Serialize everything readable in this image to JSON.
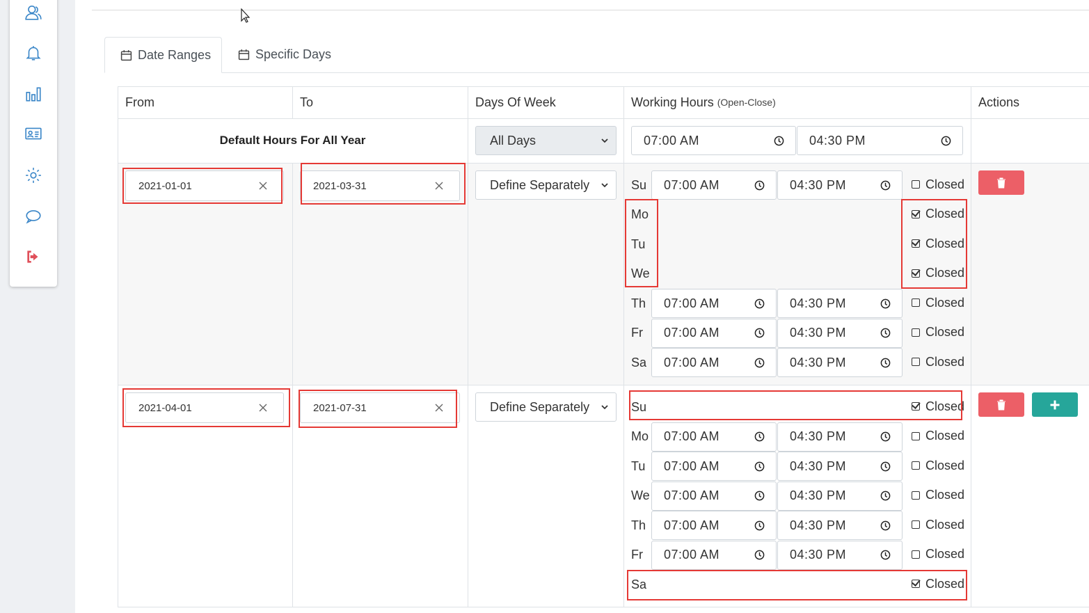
{
  "sidebar": {
    "icons": [
      "users-icon",
      "bell-icon",
      "bar-chart-icon",
      "id-card-icon",
      "gear-icon",
      "chat-icon",
      "sign-out-icon"
    ]
  },
  "tabs": [
    {
      "label": "Date Ranges",
      "icon": "calendar-icon",
      "active": true
    },
    {
      "label": "Specific Days",
      "icon": "calendar-icon",
      "active": false
    }
  ],
  "table": {
    "headers": {
      "from": "From",
      "to": "To",
      "days_of_week": "Days Of Week",
      "working_hours": "Working Hours",
      "working_hours_note": "(Open-Close)",
      "actions": "Actions"
    },
    "default_row": {
      "label": "Default Hours For All Year",
      "days": "All Days",
      "open": "07:00 AM",
      "close": "04:30 PM"
    },
    "ranges": [
      {
        "from": "2021-01-01",
        "to": "2021-03-31",
        "days": "Define Separately",
        "schedule": [
          {
            "day": "Su",
            "open": "07:00 AM",
            "close": "04:30 PM",
            "closed": false
          },
          {
            "day": "Mo",
            "closed": true
          },
          {
            "day": "Tu",
            "closed": true
          },
          {
            "day": "We",
            "closed": true
          },
          {
            "day": "Th",
            "open": "07:00 AM",
            "close": "04:30 PM",
            "closed": false
          },
          {
            "day": "Fr",
            "open": "07:00 AM",
            "close": "04:30 PM",
            "closed": false
          },
          {
            "day": "Sa",
            "open": "07:00 AM",
            "close": "04:30 PM",
            "closed": false
          }
        ]
      },
      {
        "from": "2021-04-01",
        "to": "2021-07-31",
        "days": "Define Separately",
        "schedule": [
          {
            "day": "Su",
            "closed": true
          },
          {
            "day": "Mo",
            "open": "07:00 AM",
            "close": "04:30 PM",
            "closed": false
          },
          {
            "day": "Tu",
            "open": "07:00 AM",
            "close": "04:30 PM",
            "closed": false
          },
          {
            "day": "We",
            "open": "07:00 AM",
            "close": "04:30 PM",
            "closed": false
          },
          {
            "day": "Th",
            "open": "07:00 AM",
            "close": "04:30 PM",
            "closed": false
          },
          {
            "day": "Fr",
            "open": "07:00 AM",
            "close": "04:30 PM",
            "closed": false
          },
          {
            "day": "Sa",
            "closed": true
          }
        ]
      }
    ],
    "closed_label": "Closed"
  },
  "colors": {
    "accent": "#3a86c8",
    "danger": "#ec5f67",
    "success": "#26a69a",
    "highlight": "#e53935"
  }
}
